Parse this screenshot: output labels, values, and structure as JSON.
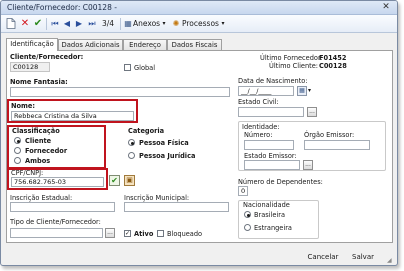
{
  "window": {
    "title": "Cliente/Fornecedor: C00128 -",
    "close_glyph": "✕"
  },
  "toolbar": {
    "record_pos": "3/4",
    "annexes_label": "Anexos",
    "processes_label": "Processos"
  },
  "tabs": [
    "Identificação",
    "Dados Adicionais",
    "Endereço",
    "Dados Fiscais"
  ],
  "summary": {
    "last_supplier_label": "Último Fornecedor:",
    "last_supplier_value": "F01452",
    "last_client_label": "Último Cliente:",
    "last_client_value": "C00128"
  },
  "form": {
    "code_label": "Cliente/Fornecedor:",
    "code_value": "C00128",
    "global_label": "Global",
    "fantasy_label": "Nome Fantasia:",
    "fantasy_value": "",
    "name_label": "Nome:",
    "name_value": "Rebbeca Cristina da Silva",
    "classification": {
      "label": "Classificação",
      "options": [
        "Cliente",
        "Fornecedor",
        "Ambos"
      ],
      "selected": "Cliente"
    },
    "category": {
      "label": "Categoria",
      "options": [
        "Pessoa Física",
        "Pessoa Jurídica"
      ],
      "selected": "Pessoa Física"
    },
    "cpf_label": "CPF/CNPJ:",
    "cpf_value": "756.682.765-03",
    "state_reg_label": "Inscrição Estadual:",
    "municipal_reg_label": "Inscrição Municipal:",
    "type_label": "Tipo de Cliente/Fornecedor:",
    "active_label": "Ativo",
    "blocked_label": "Bloqueado",
    "birth_label": "Data de Nascimento:",
    "birth_value": "__/__/____",
    "civil_label": "Estado Civil:",
    "identity": {
      "label": "Identidade:",
      "number_label": "Número:",
      "issuer_label": "Órgão Emissor:",
      "issuer_state_label": "Estado Emissor:"
    },
    "dependents_label": "Número de Dependentes:",
    "dependents_value": "0",
    "nationality": {
      "label": "Nacionalidade",
      "options": [
        "Brasileira",
        "Estrangeira"
      ],
      "selected": "Brasileira"
    },
    "lookup_glyph": "..."
  },
  "footer": {
    "cancel_label": "Cancelar",
    "save_label": "Salvar"
  },
  "colors": {
    "highlight": "#c0141e",
    "titlebar": "#c7d7ee"
  },
  "icons": [
    "new-icon",
    "delete-icon",
    "check-icon",
    "first-icon",
    "prev-icon",
    "next-icon",
    "last-icon",
    "annex-icon",
    "gear-icon",
    "calendar-icon"
  ]
}
